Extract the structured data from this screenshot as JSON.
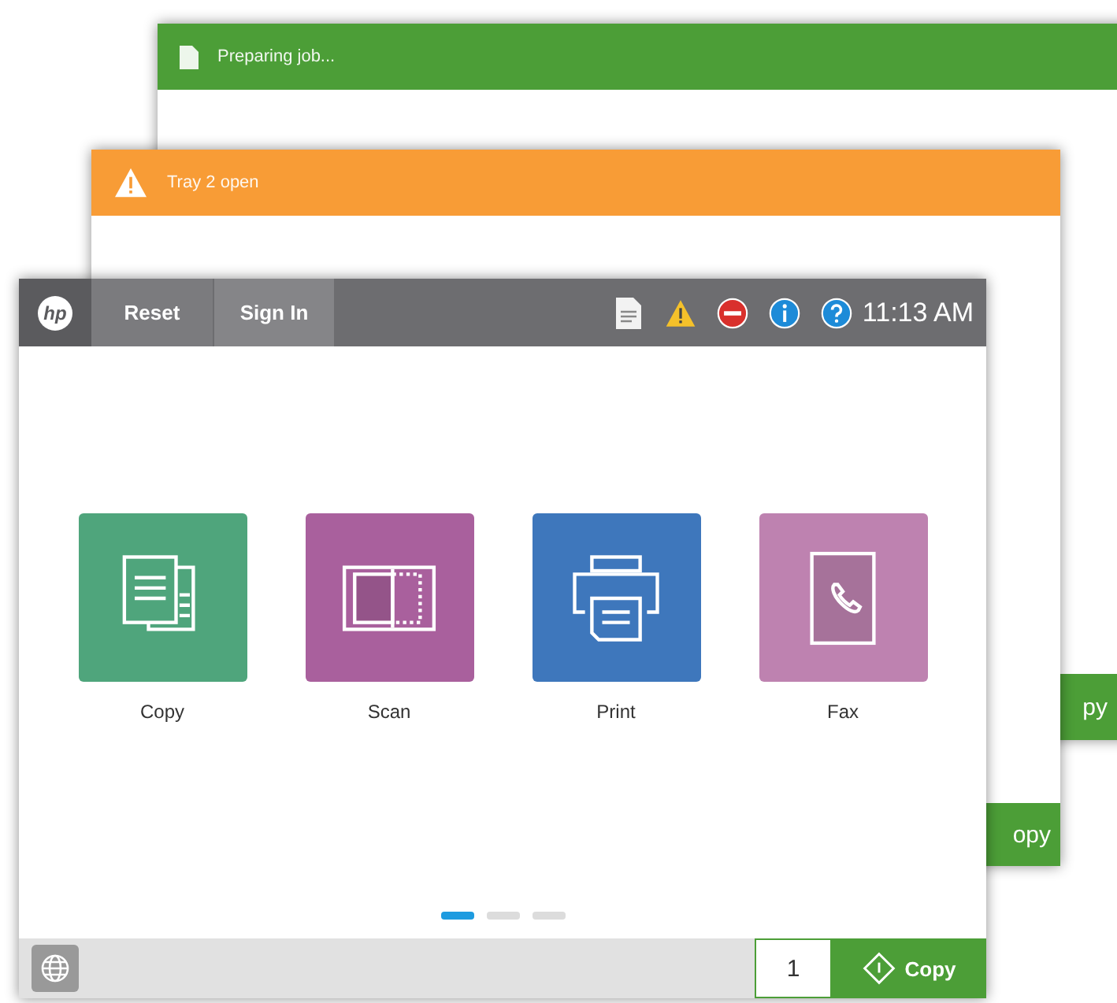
{
  "back_window": {
    "message": "Preparing job...",
    "button": "py"
  },
  "middle_window": {
    "message": "Tray 2 open",
    "button": "opy"
  },
  "front_window": {
    "logo": "hp",
    "tabs": [
      {
        "label": "Reset"
      },
      {
        "label": "Sign In"
      }
    ],
    "time": "11:13 AM",
    "apps": [
      {
        "kind": "copy",
        "label": "Copy",
        "color": "#4fa57c"
      },
      {
        "kind": "scan",
        "label": "Scan",
        "color": "#a9609d"
      },
      {
        "kind": "print",
        "label": "Print",
        "color": "#3e77bc"
      },
      {
        "kind": "fax",
        "label": "Fax",
        "color": "#be82b0"
      }
    ],
    "pages": [
      {
        "selected": true
      },
      {
        "selected": false
      },
      {
        "selected": false
      }
    ],
    "copies": "1",
    "start_button": "Copy"
  }
}
